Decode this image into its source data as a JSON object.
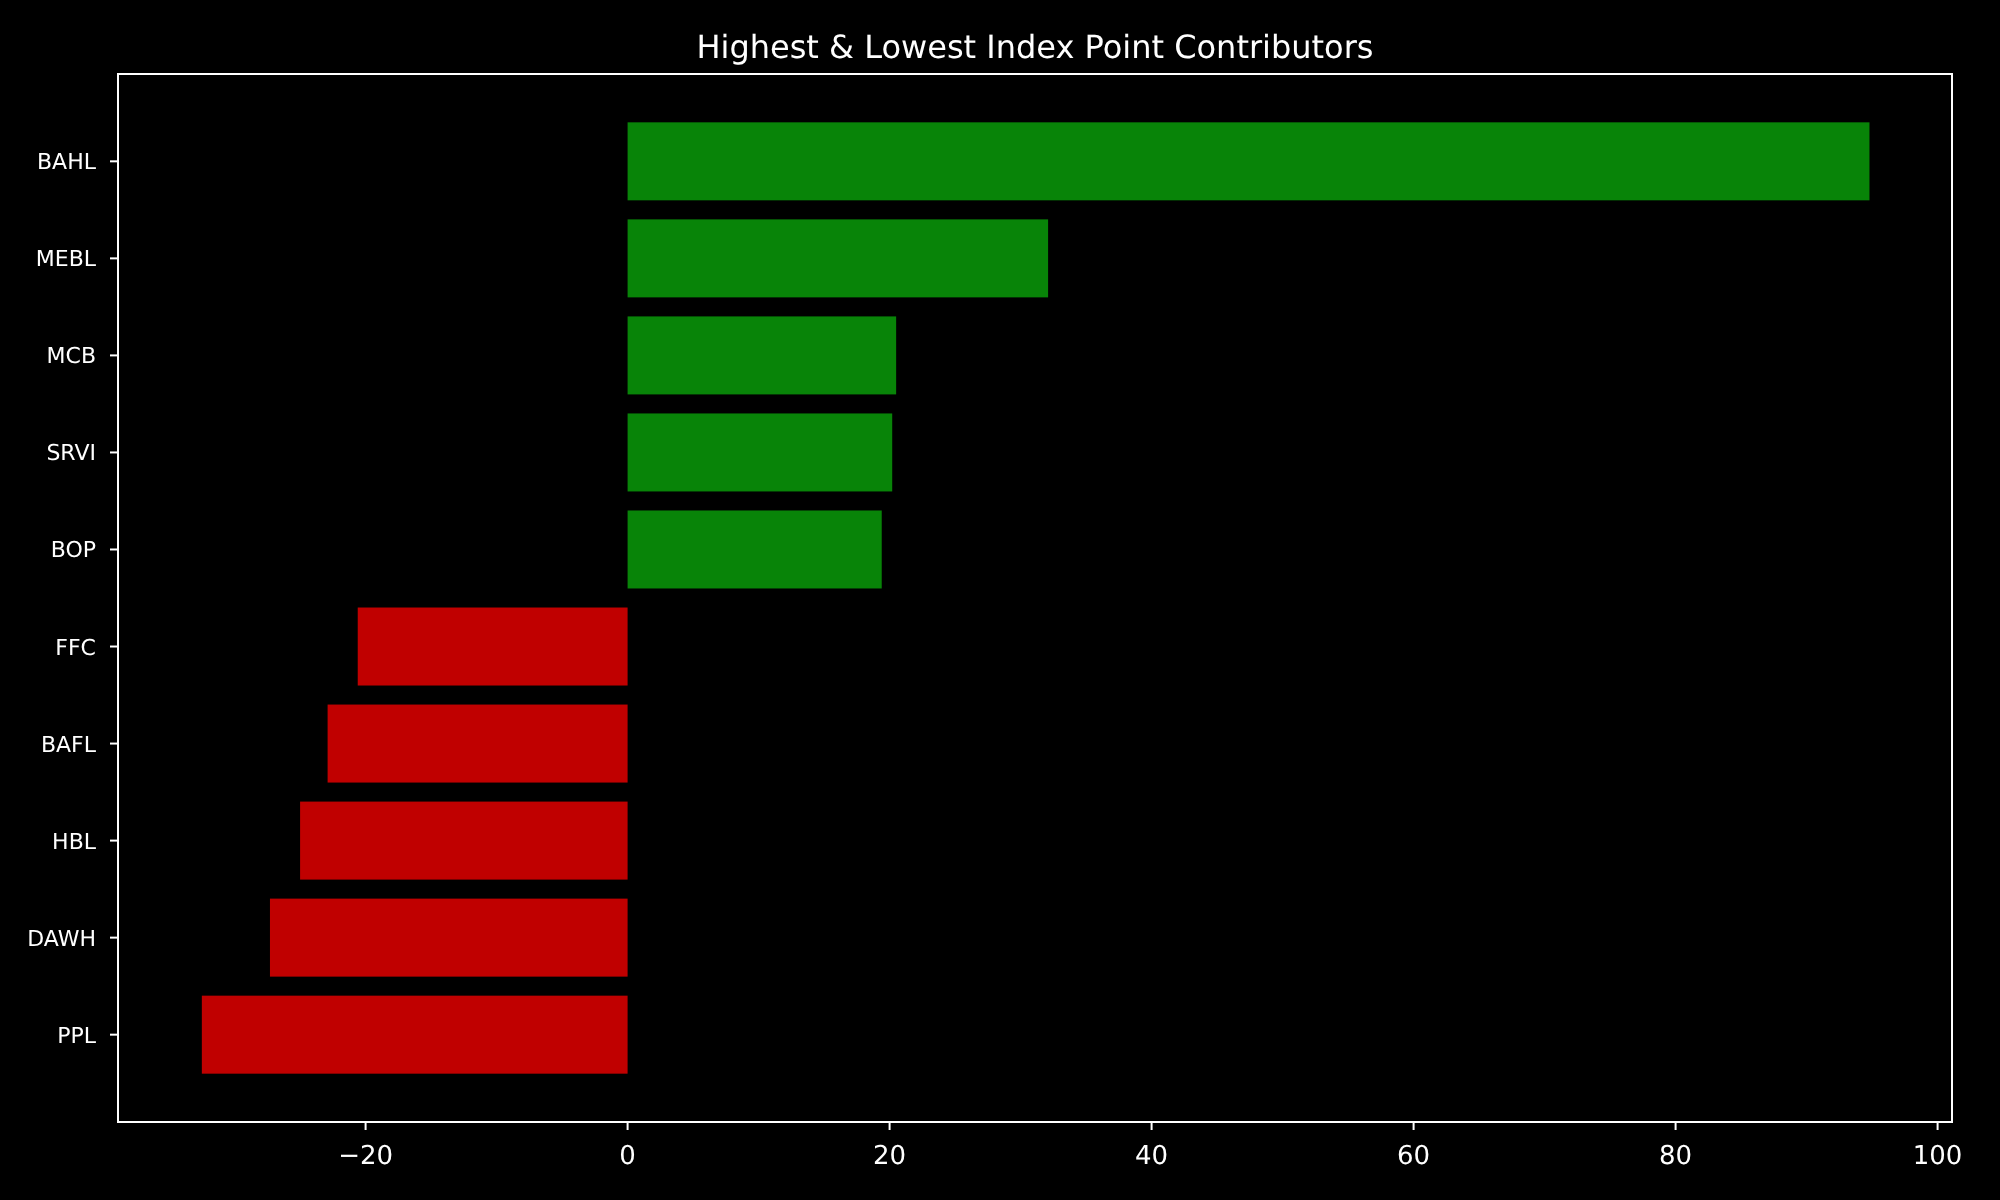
{
  "chart_data": {
    "type": "bar",
    "orientation": "horizontal",
    "title": "Highest & Lowest Index Point Contributors",
    "categories": [
      "BAHL",
      "MEBL",
      "MCB",
      "SRVI",
      "BOP",
      "FFC",
      "BAFL",
      "HBL",
      "DAWH",
      "PPL"
    ],
    "stacked": true,
    "series": [
      {
        "color": "#088408",
        "values": [
          94.8,
          32.1,
          20.5,
          20.2,
          19.4,
          null,
          null,
          null,
          null,
          null
        ]
      },
      {
        "color": "#c00000",
        "values": [
          null,
          null,
          null,
          null,
          null,
          -20.6,
          -22.9,
          -25.0,
          -27.3,
          -32.5
        ]
      }
    ],
    "xlim": [
      -38.9,
      101.1
    ],
    "xticks": [
      {
        "value": -20,
        "label": "−20"
      },
      {
        "value": 0,
        "label": "0"
      },
      20,
      40,
      60,
      80,
      100
    ]
  }
}
